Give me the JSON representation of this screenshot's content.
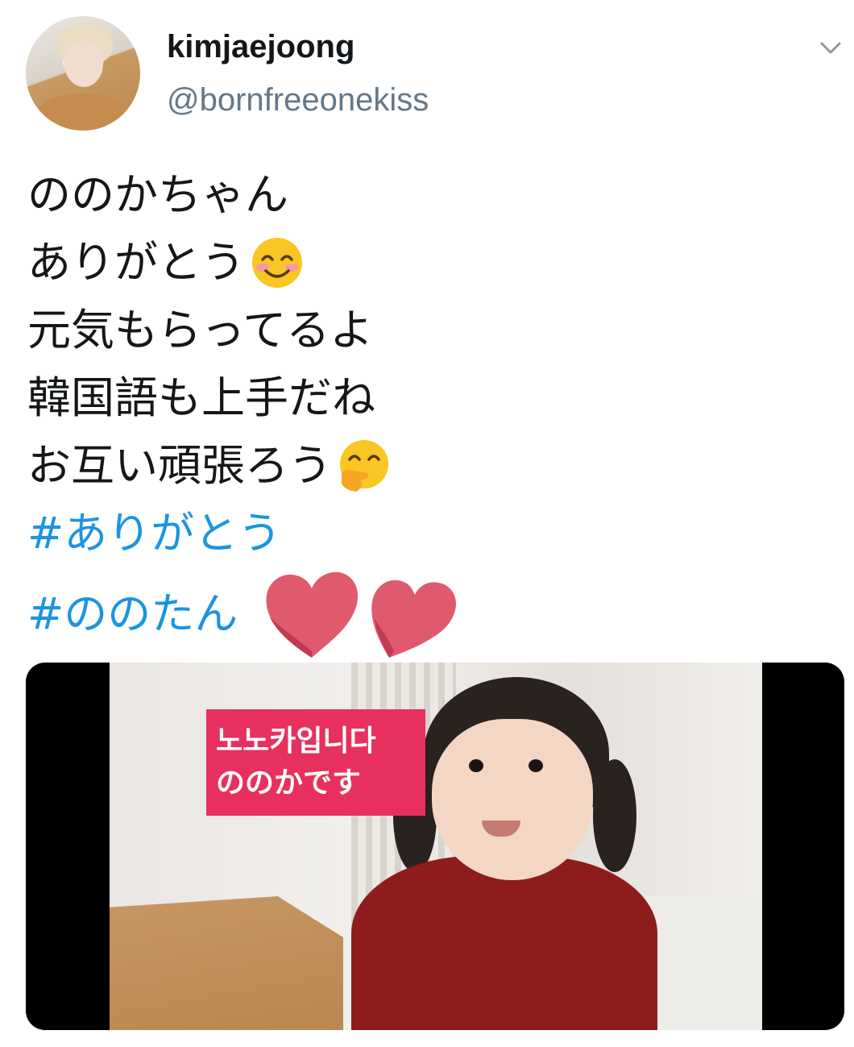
{
  "tweet": {
    "display_name": "kimjaejoong",
    "handle": "@bornfreeonekiss",
    "lines": [
      "ののかちゃん",
      "ありがとう",
      "元気もらってるよ",
      "韓国語も上手だね",
      "お互い頑張ろう"
    ],
    "hashtags": [
      "#ありがとう",
      "#ののたん"
    ]
  },
  "media": {
    "caption_line1": "노노카입니다",
    "caption_line2": "ののかです"
  },
  "colors": {
    "hashtag": "#1b95e0",
    "handle": "#657786",
    "caption_bg": "#e8305f",
    "heart": "#e05a6e"
  },
  "icons": {
    "chevron": "chevron-down-icon",
    "emoji_1": "smiling-face-with-smiling-eyes-emoji",
    "emoji_2": "face-with-hand-over-mouth-emoji",
    "hearts": "heart-icon"
  }
}
